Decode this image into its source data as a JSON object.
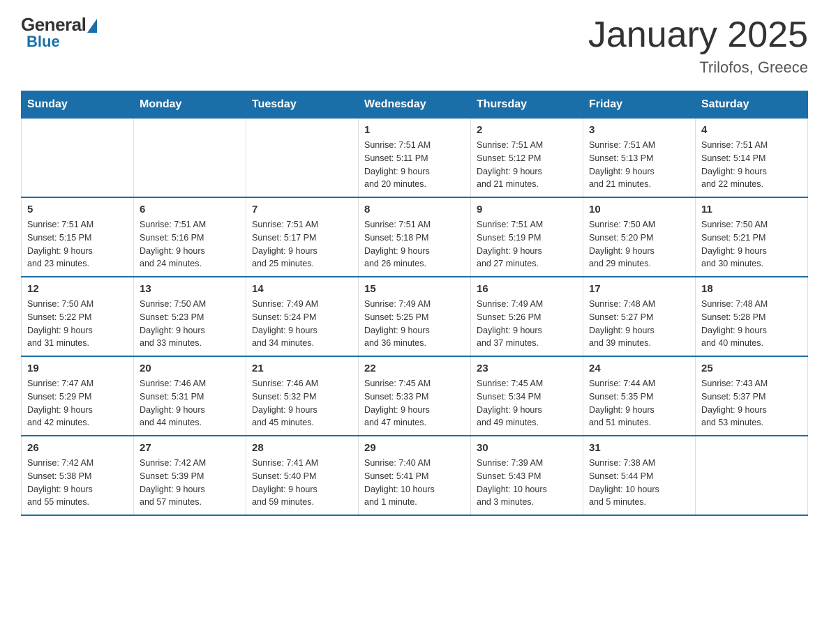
{
  "header": {
    "logo_general": "General",
    "logo_blue": "Blue",
    "title": "January 2025",
    "subtitle": "Trilofos, Greece"
  },
  "calendar": {
    "days_of_week": [
      "Sunday",
      "Monday",
      "Tuesday",
      "Wednesday",
      "Thursday",
      "Friday",
      "Saturday"
    ],
    "weeks": [
      [
        {
          "day": "",
          "info": ""
        },
        {
          "day": "",
          "info": ""
        },
        {
          "day": "",
          "info": ""
        },
        {
          "day": "1",
          "info": "Sunrise: 7:51 AM\nSunset: 5:11 PM\nDaylight: 9 hours\nand 20 minutes."
        },
        {
          "day": "2",
          "info": "Sunrise: 7:51 AM\nSunset: 5:12 PM\nDaylight: 9 hours\nand 21 minutes."
        },
        {
          "day": "3",
          "info": "Sunrise: 7:51 AM\nSunset: 5:13 PM\nDaylight: 9 hours\nand 21 minutes."
        },
        {
          "day": "4",
          "info": "Sunrise: 7:51 AM\nSunset: 5:14 PM\nDaylight: 9 hours\nand 22 minutes."
        }
      ],
      [
        {
          "day": "5",
          "info": "Sunrise: 7:51 AM\nSunset: 5:15 PM\nDaylight: 9 hours\nand 23 minutes."
        },
        {
          "day": "6",
          "info": "Sunrise: 7:51 AM\nSunset: 5:16 PM\nDaylight: 9 hours\nand 24 minutes."
        },
        {
          "day": "7",
          "info": "Sunrise: 7:51 AM\nSunset: 5:17 PM\nDaylight: 9 hours\nand 25 minutes."
        },
        {
          "day": "8",
          "info": "Sunrise: 7:51 AM\nSunset: 5:18 PM\nDaylight: 9 hours\nand 26 minutes."
        },
        {
          "day": "9",
          "info": "Sunrise: 7:51 AM\nSunset: 5:19 PM\nDaylight: 9 hours\nand 27 minutes."
        },
        {
          "day": "10",
          "info": "Sunrise: 7:50 AM\nSunset: 5:20 PM\nDaylight: 9 hours\nand 29 minutes."
        },
        {
          "day": "11",
          "info": "Sunrise: 7:50 AM\nSunset: 5:21 PM\nDaylight: 9 hours\nand 30 minutes."
        }
      ],
      [
        {
          "day": "12",
          "info": "Sunrise: 7:50 AM\nSunset: 5:22 PM\nDaylight: 9 hours\nand 31 minutes."
        },
        {
          "day": "13",
          "info": "Sunrise: 7:50 AM\nSunset: 5:23 PM\nDaylight: 9 hours\nand 33 minutes."
        },
        {
          "day": "14",
          "info": "Sunrise: 7:49 AM\nSunset: 5:24 PM\nDaylight: 9 hours\nand 34 minutes."
        },
        {
          "day": "15",
          "info": "Sunrise: 7:49 AM\nSunset: 5:25 PM\nDaylight: 9 hours\nand 36 minutes."
        },
        {
          "day": "16",
          "info": "Sunrise: 7:49 AM\nSunset: 5:26 PM\nDaylight: 9 hours\nand 37 minutes."
        },
        {
          "day": "17",
          "info": "Sunrise: 7:48 AM\nSunset: 5:27 PM\nDaylight: 9 hours\nand 39 minutes."
        },
        {
          "day": "18",
          "info": "Sunrise: 7:48 AM\nSunset: 5:28 PM\nDaylight: 9 hours\nand 40 minutes."
        }
      ],
      [
        {
          "day": "19",
          "info": "Sunrise: 7:47 AM\nSunset: 5:29 PM\nDaylight: 9 hours\nand 42 minutes."
        },
        {
          "day": "20",
          "info": "Sunrise: 7:46 AM\nSunset: 5:31 PM\nDaylight: 9 hours\nand 44 minutes."
        },
        {
          "day": "21",
          "info": "Sunrise: 7:46 AM\nSunset: 5:32 PM\nDaylight: 9 hours\nand 45 minutes."
        },
        {
          "day": "22",
          "info": "Sunrise: 7:45 AM\nSunset: 5:33 PM\nDaylight: 9 hours\nand 47 minutes."
        },
        {
          "day": "23",
          "info": "Sunrise: 7:45 AM\nSunset: 5:34 PM\nDaylight: 9 hours\nand 49 minutes."
        },
        {
          "day": "24",
          "info": "Sunrise: 7:44 AM\nSunset: 5:35 PM\nDaylight: 9 hours\nand 51 minutes."
        },
        {
          "day": "25",
          "info": "Sunrise: 7:43 AM\nSunset: 5:37 PM\nDaylight: 9 hours\nand 53 minutes."
        }
      ],
      [
        {
          "day": "26",
          "info": "Sunrise: 7:42 AM\nSunset: 5:38 PM\nDaylight: 9 hours\nand 55 minutes."
        },
        {
          "day": "27",
          "info": "Sunrise: 7:42 AM\nSunset: 5:39 PM\nDaylight: 9 hours\nand 57 minutes."
        },
        {
          "day": "28",
          "info": "Sunrise: 7:41 AM\nSunset: 5:40 PM\nDaylight: 9 hours\nand 59 minutes."
        },
        {
          "day": "29",
          "info": "Sunrise: 7:40 AM\nSunset: 5:41 PM\nDaylight: 10 hours\nand 1 minute."
        },
        {
          "day": "30",
          "info": "Sunrise: 7:39 AM\nSunset: 5:43 PM\nDaylight: 10 hours\nand 3 minutes."
        },
        {
          "day": "31",
          "info": "Sunrise: 7:38 AM\nSunset: 5:44 PM\nDaylight: 10 hours\nand 5 minutes."
        },
        {
          "day": "",
          "info": ""
        }
      ]
    ]
  }
}
